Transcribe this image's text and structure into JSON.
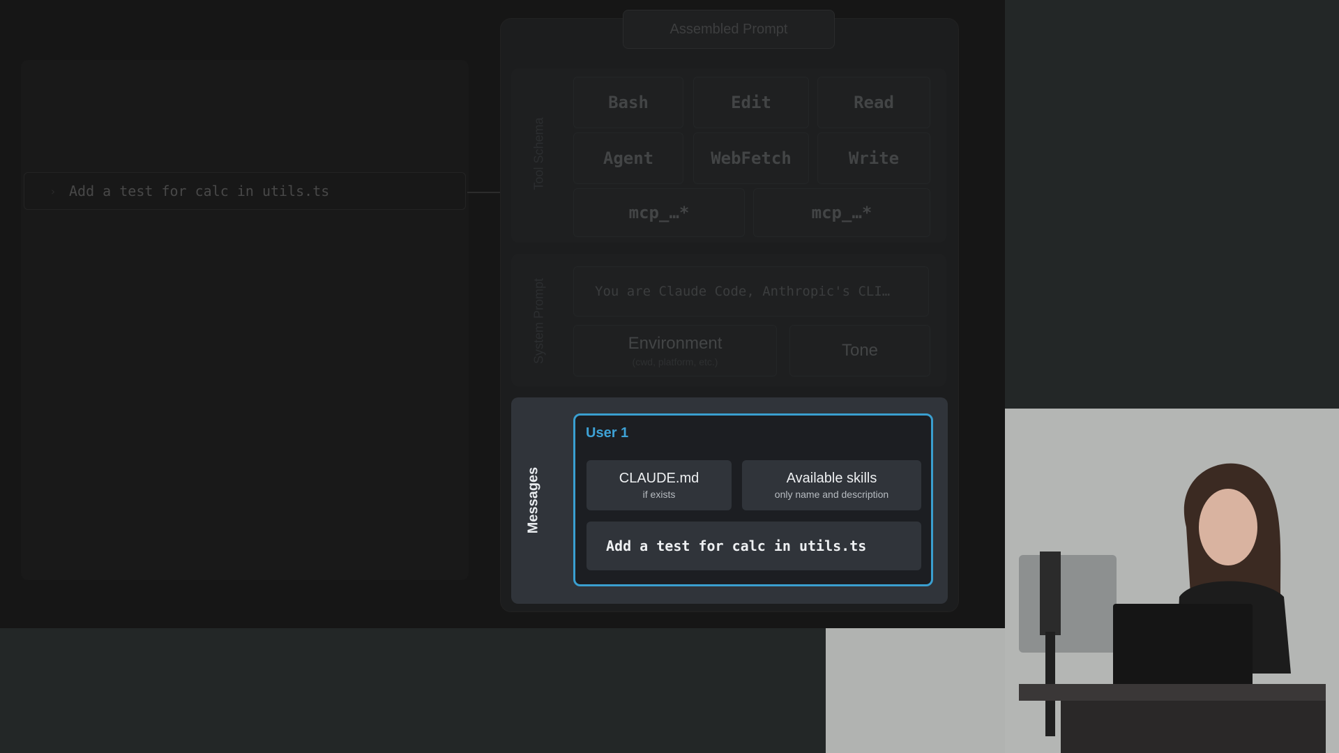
{
  "left_panel": {
    "caption": "",
    "input_text": "Add a test for calc in utils.ts"
  },
  "assembled_prompt": {
    "title": "Assembled Prompt",
    "tool_schema": {
      "label": "Tool Schema",
      "tools": [
        "Bash",
        "Edit",
        "Read",
        "Agent",
        "WebFetch",
        "Write",
        "mcp_…*",
        "mcp_…*"
      ]
    },
    "system_prompt": {
      "label": "System Prompt",
      "text": "You are Claude Code, Anthropic's CLI…",
      "environment": "Environment",
      "environment_sub": "(cwd, platform, etc.)",
      "tone": "Tone"
    },
    "messages": {
      "label": "Messages",
      "user_title": "User 1",
      "claude_md": "CLAUDE.md",
      "claude_md_sub": "if exists",
      "skills": "Available skills",
      "skills_sub": "only name and description",
      "user_input": "Add a test for calc in utils.ts"
    }
  },
  "colors": {
    "accent": "#3a9fd0",
    "slide_bg": "#161616",
    "page_bg": "#232727",
    "messages_bg": "#30343a"
  }
}
